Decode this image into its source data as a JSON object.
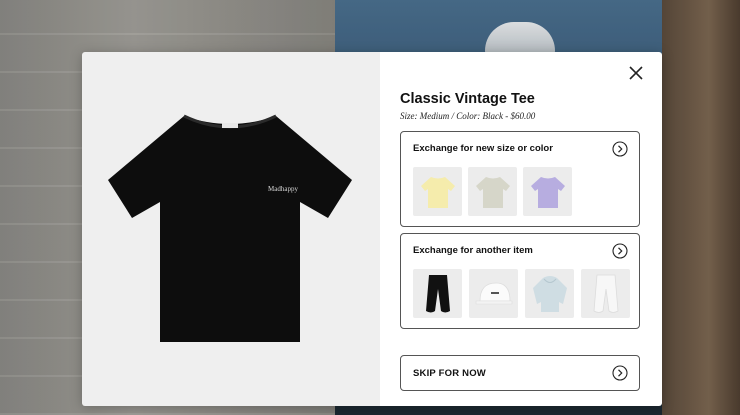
{
  "modal": {
    "product": {
      "title": "Classic Vintage Tee",
      "details": "Size: Medium / Color: Black - $60.00",
      "brand_print": "Madhappy"
    },
    "options": [
      {
        "label": "Exchange for new size or color",
        "thumbnails": [
          {
            "icon": "yellow-tee-icon",
            "color": "#f5ecac"
          },
          {
            "icon": "sage-tee-icon",
            "color": "#d6d6c9"
          },
          {
            "icon": "lavender-tee-icon",
            "color": "#b7ade0"
          }
        ]
      },
      {
        "label": "Exchange for another item",
        "thumbnails": [
          {
            "icon": "black-sweatpants-icon",
            "color": "#111111"
          },
          {
            "icon": "white-cap-icon",
            "color": "#f5f5f5"
          },
          {
            "icon": "light-blue-hoodie-icon",
            "color": "#cfdde3"
          },
          {
            "icon": "white-sweatpants-icon",
            "color": "#f3f3f3"
          }
        ]
      }
    ],
    "skip_label": "SKIP FOR NOW"
  },
  "colors": {
    "accent_border": "#555555",
    "product_color": "#0d0d0d"
  }
}
